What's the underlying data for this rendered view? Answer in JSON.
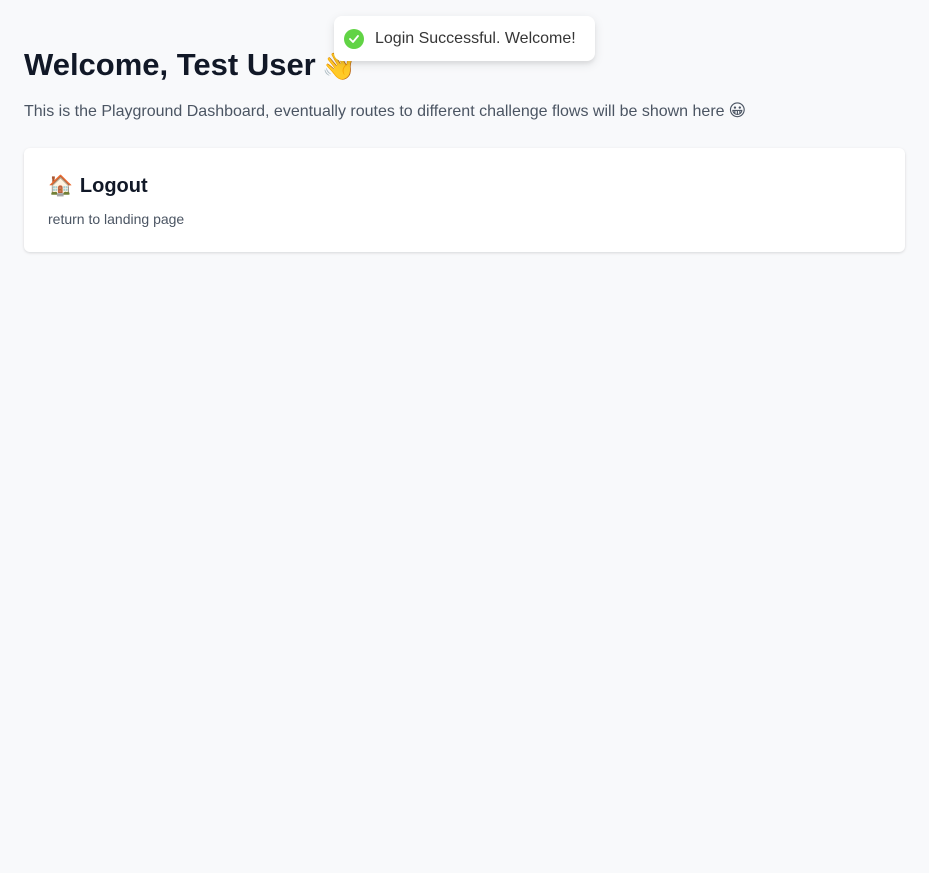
{
  "header": {
    "title": "Welcome, Test User",
    "title_emoji": "👋",
    "subtitle": "This is the Playground Dashboard, eventually routes to different challenge flows will be shown here",
    "subtitle_emoji": "😀"
  },
  "cards": [
    {
      "icon": "house-emoji",
      "emoji": "🏠",
      "title": "Logout",
      "description": "return to landing page"
    }
  ],
  "toast": {
    "message": "Login Successful. Welcome!",
    "status": "success",
    "icon": "checkmark-icon",
    "color": "#61d345"
  },
  "colors": {
    "background": "#f8f9fb",
    "card": "#ffffff",
    "heading": "#111827",
    "muted": "#4b5563"
  }
}
